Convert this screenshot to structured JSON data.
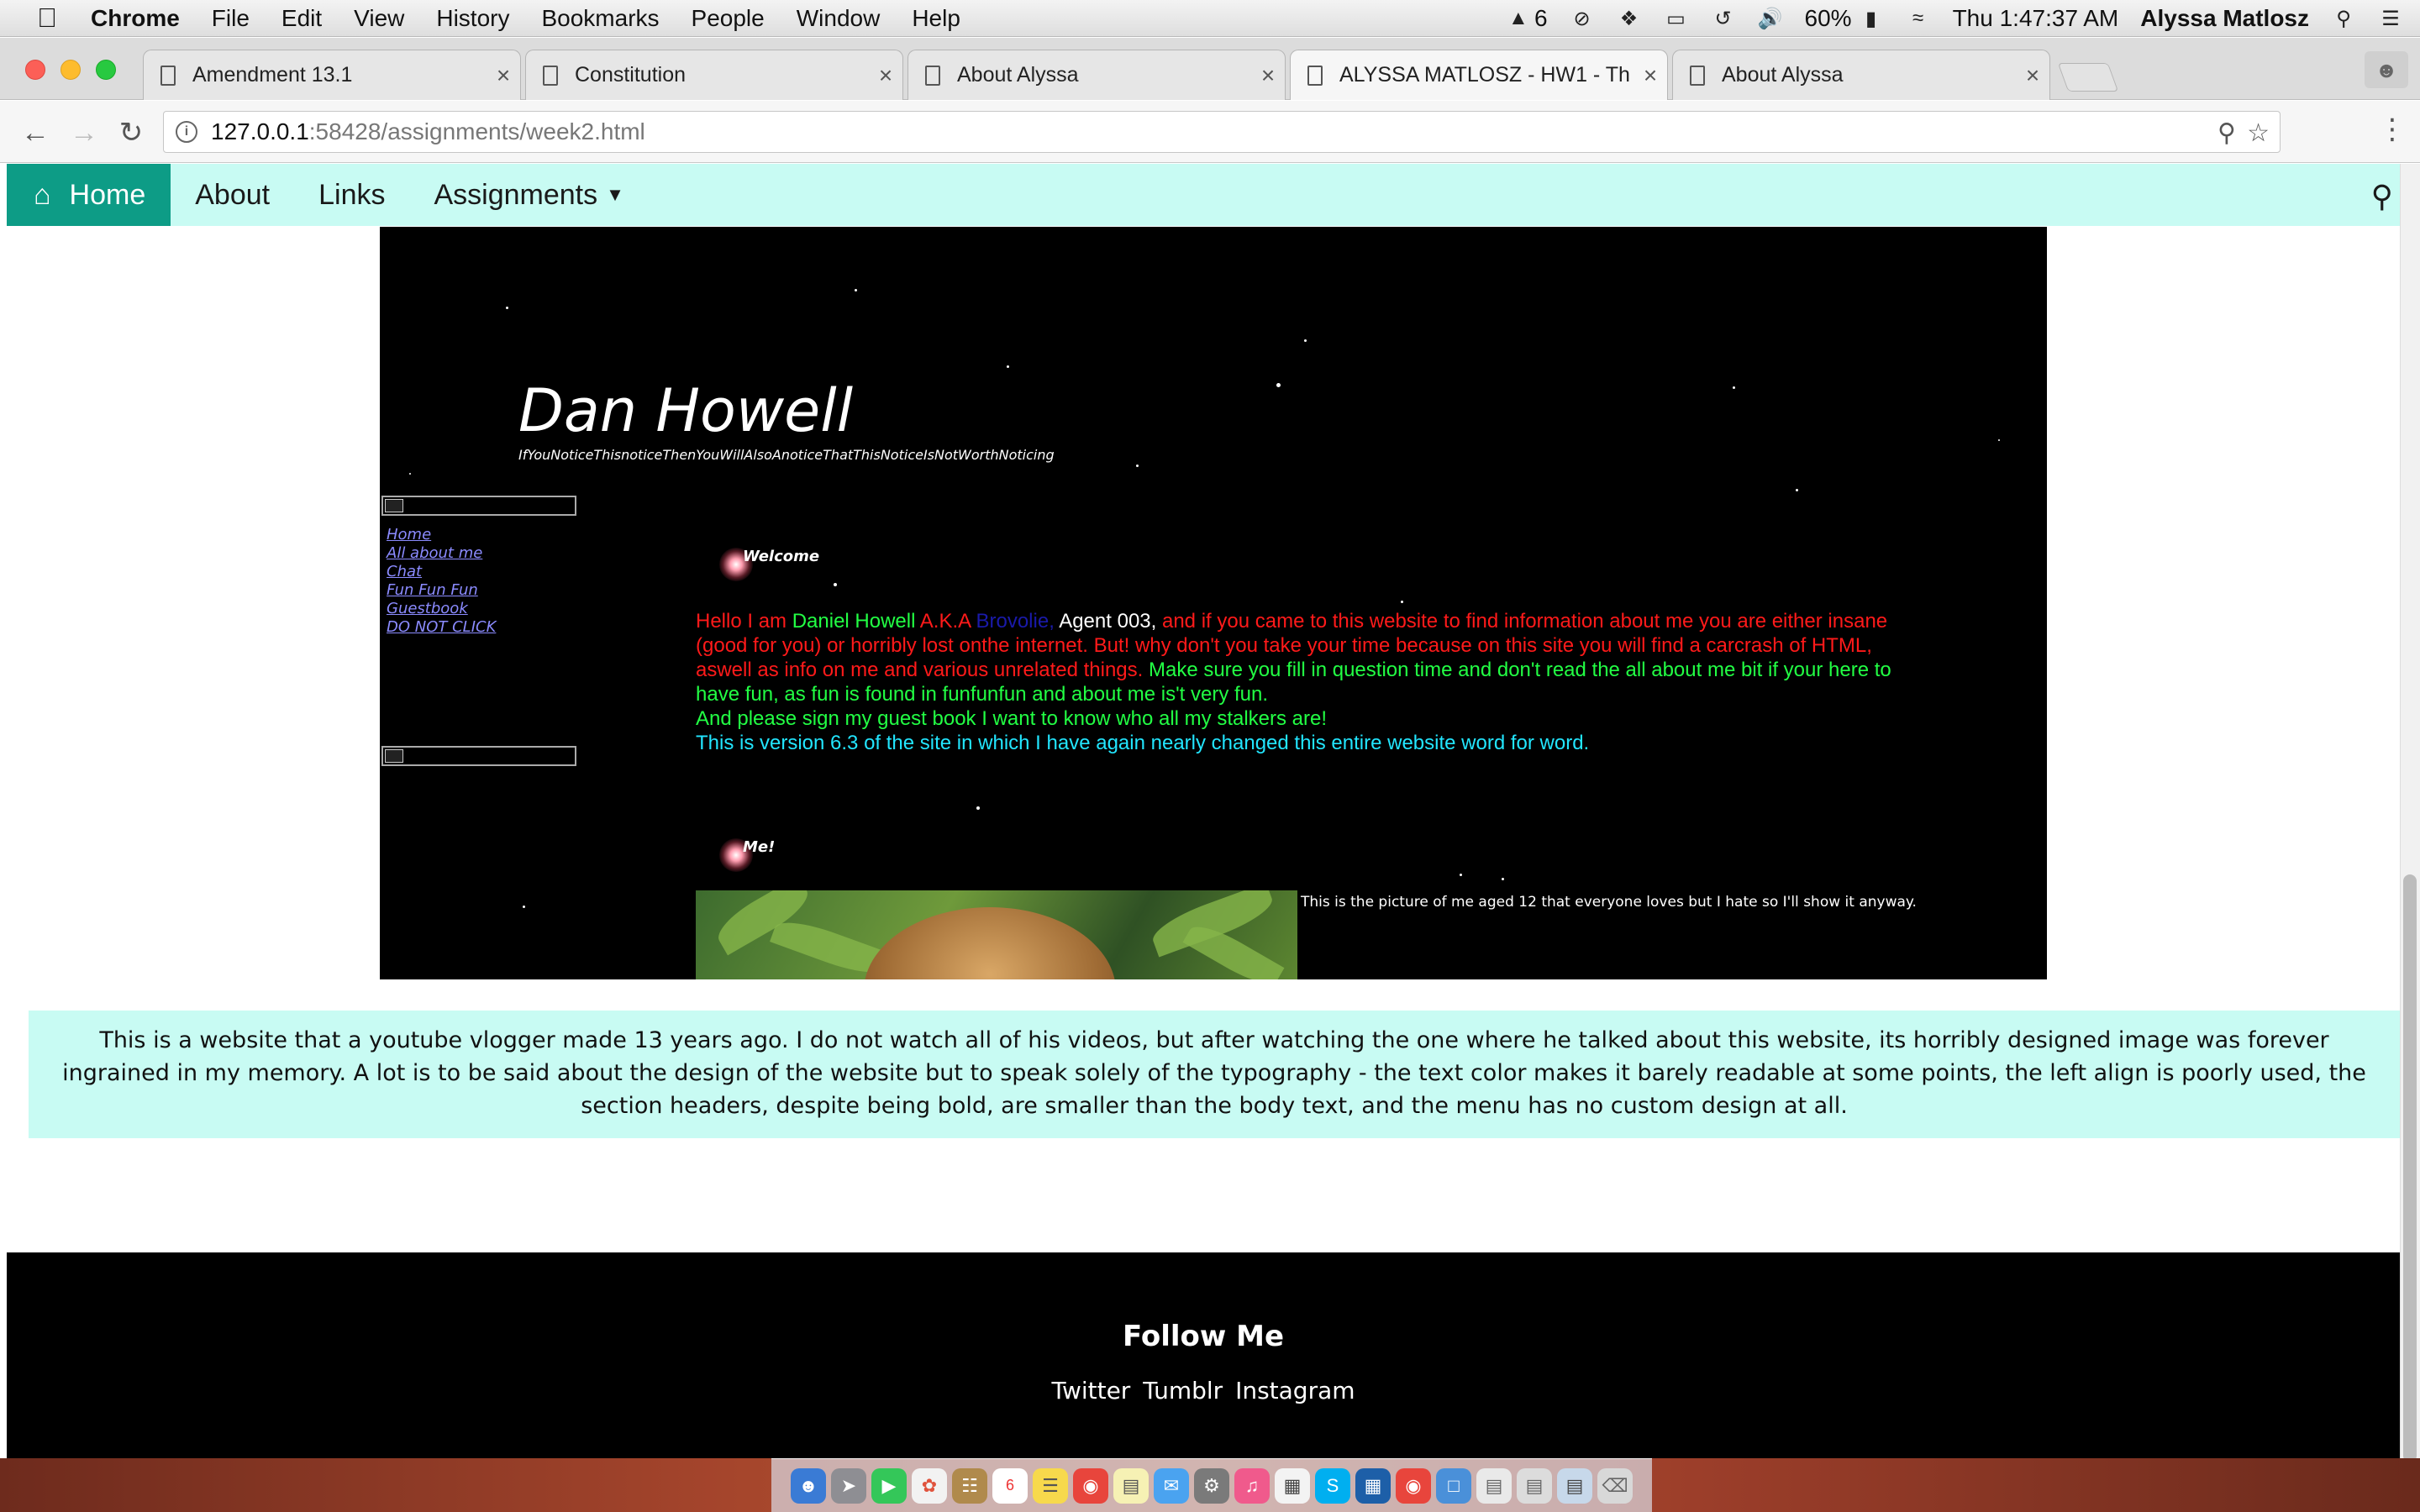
{
  "os_menubar": {
    "app": "Chrome",
    "items": [
      "File",
      "Edit",
      "View",
      "History",
      "Bookmarks",
      "People",
      "Window",
      "Help"
    ],
    "adobe_badge": "6",
    "battery": "60%",
    "clock": "Thu 1:47:37 AM",
    "user": "Alyssa Matlosz"
  },
  "tabs": [
    {
      "label": "Amendment 13.1"
    },
    {
      "label": "Constitution"
    },
    {
      "label": "About Alyssa"
    },
    {
      "label": "ALYSSA MATLOSZ - HW1 - Th"
    },
    {
      "label": "About Alyssa"
    }
  ],
  "toolbar": {
    "url_host": "127.0.0.1",
    "url_path": ":58428/assignments/week2.html"
  },
  "site_nav": {
    "home": "Home",
    "about": "About",
    "links": "Links",
    "assignments": "Assignments"
  },
  "embed": {
    "title": "Dan Howell",
    "subtitle": "IfYouNoticeThisnoticeThenYouWillAlsoAnoticeThatThisNoticeIsNotWorthNoticing",
    "links": [
      "Home",
      "All about me",
      "Chat",
      "Fun Fun Fun",
      "Guestbook",
      "DO NOT CLICK"
    ],
    "welcome_heading": "Welcome",
    "t1": "Hello I am ",
    "t2": "Daniel Howell",
    "t3": " A.K.A ",
    "t4": "Brovolie,",
    "t5": " Agent 003,",
    "t6": " and if you came to this website to find information about me you are either insane (good for you) or horribly lost onthe internet. But! why don't you take your time because on this site you will find a carcrash of HTML, aswell as info on me and various unrelated things.",
    "t7": " Make sure you fill in question time and don't read the all about me bit if your here to have fun, as fun is found in funfunfun and about me is't very fun.",
    "t8": "And please sign my guest book I want to know who all my stalkers are!",
    "t9": "This is version 6.3 of the site in which I have again nearly changed this entire website word for word.",
    "me_heading": "Me!",
    "caption": "This is the picture of me aged 12 that everyone loves but I hate so I'll show it anyway."
  },
  "description": "This is a website that a youtube vlogger made 13 years ago. I do not watch all of his videos, but after watching the one where he talked about this website, its horribly designed image was forever ingrained in my memory. A lot is to be said about the design of the website but to speak solely of the typography - the text color makes it barely readable at some points, the left align is poorly used, the section headers, despite being bold, are smaller than the body text, and the menu has no custom design at all.",
  "footer": {
    "heading": "Follow Me",
    "twitter": "Twitter",
    "tumblr": "Tumblr",
    "instagram": "Instagram"
  },
  "dock": {
    "calendar_day": "6"
  },
  "colors": {
    "nav_bg": "#c8fbf3",
    "home_bg": "#0d9c86",
    "text_red": "#ff1a1a",
    "text_green": "#22ff44",
    "text_cyan": "#22e6ff",
    "text_blue": "#1a1aaa"
  }
}
